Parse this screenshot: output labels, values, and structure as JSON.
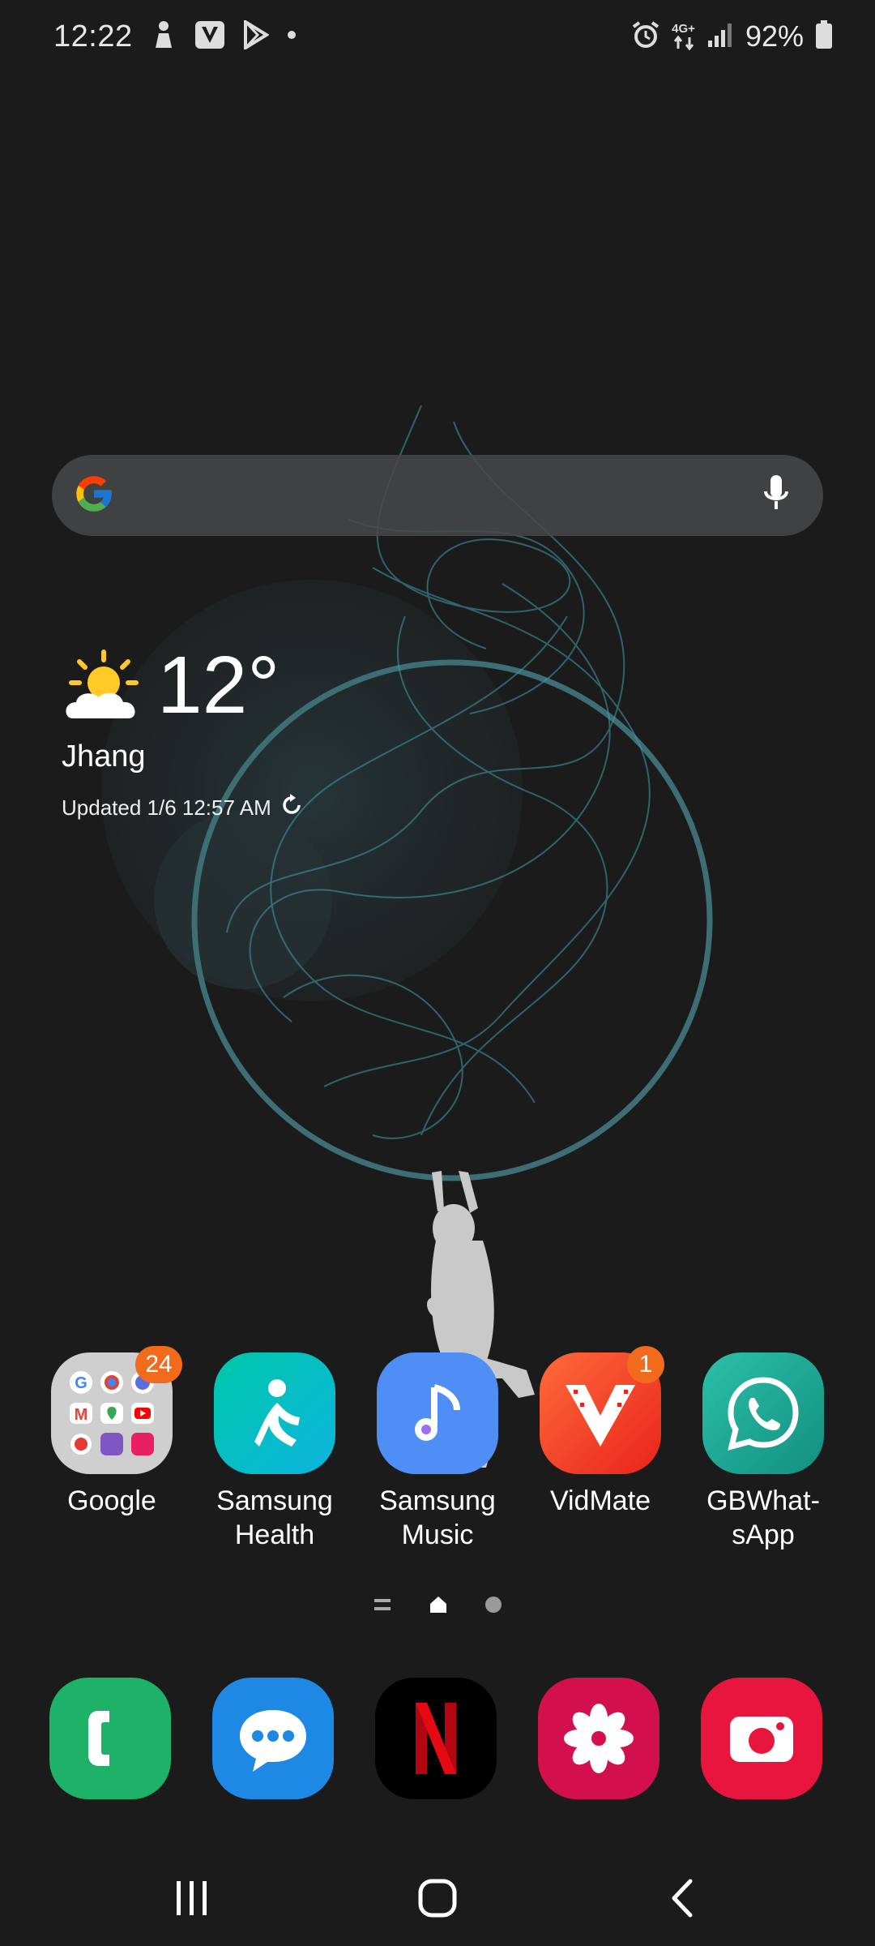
{
  "status_bar": {
    "time": "12:22",
    "network": "4G+",
    "battery": "92%",
    "battery_level": 0.92,
    "icons": [
      "person-notification-icon",
      "vidmate-notification-icon",
      "play-store-icon",
      "dot-icon",
      "alarm-icon",
      "data-arrows-icon",
      "signal-icon",
      "battery-icon"
    ]
  },
  "search": {
    "icons": [
      "google-g-icon",
      "mic-icon"
    ]
  },
  "weather": {
    "temperature": "12°",
    "city": "Jhang",
    "updated": "Updated 1/6 12:57 AM",
    "icon": "partly-sunny-icon"
  },
  "apps": [
    {
      "label": "Google",
      "badge": "24",
      "icon": "google-folder-icon"
    },
    {
      "label": "Samsung Health",
      "badge": "",
      "icon": "samsung-health-icon"
    },
    {
      "label": "Samsung Music",
      "badge": "",
      "icon": "samsung-music-icon"
    },
    {
      "label": "VidMate",
      "badge": "1",
      "icon": "vidmate-icon"
    },
    {
      "label": "GBWhat-sApp",
      "badge": "",
      "icon": "whatsapp-icon"
    }
  ],
  "app_labels": {
    "google": "Google",
    "health_1": "Samsung",
    "health_2": "Health",
    "music_1": "Samsung",
    "music_2": "Music",
    "vidmate": "VidMate",
    "gbwa_1": "GBWhat-",
    "gbwa_2": "sApp"
  },
  "badges": {
    "google": "24",
    "vidmate": "1"
  },
  "dock": [
    {
      "icon": "phone-icon",
      "color": "#1db268"
    },
    {
      "icon": "messages-icon",
      "color": "#1e88e5"
    },
    {
      "icon": "netflix-icon",
      "color": "#000000"
    },
    {
      "icon": "gallery-icon",
      "color": "#d2104d"
    },
    {
      "icon": "camera-icon",
      "color": "#e8163f"
    }
  ],
  "navigation": {
    "icons": [
      "recents-icon",
      "home-icon",
      "back-icon"
    ]
  },
  "colors": {
    "background": "#1b1b1b",
    "accent_teal": "#3fa0ad",
    "badge": "#f26a1b"
  }
}
